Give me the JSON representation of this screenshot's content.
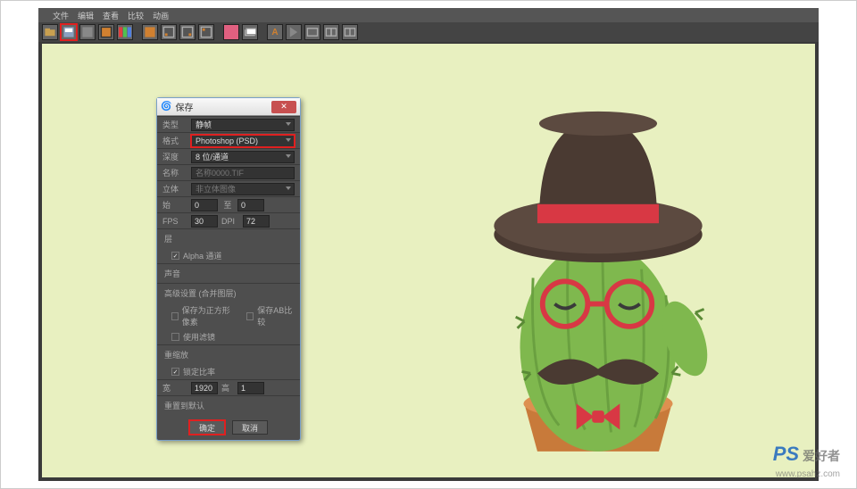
{
  "menu": {
    "items": [
      "文件",
      "编辑",
      "查看",
      "比较",
      "动画"
    ]
  },
  "dialog": {
    "title": "保存",
    "type_label": "类型",
    "type_value": "静帧",
    "format_label": "格式",
    "format_value": "Photoshop (PSD)",
    "depth_label": "深度",
    "depth_value": "8 位/通道",
    "name_label": "名称",
    "name_value": "名称0000.TIF",
    "stereo_label": "立体",
    "stereo_value": "非立体图像",
    "start_label": "始",
    "start_value": "0",
    "end_label": "至",
    "end_value": "0",
    "fps_label": "FPS",
    "fps_value": "30",
    "dpi_label": "DPI",
    "dpi_value": "72",
    "layers_section": "层",
    "alpha_label": "Alpha 通道",
    "alpha_checked": true,
    "sound_section": "声音",
    "advanced_section": "高级设置 (合并图层)",
    "square_label": "保存为正方形像素",
    "ab_label": "保存AB比较",
    "filter_label": "使用滤镜",
    "rescale_section": "重缩放",
    "lock_label": "锁定比率",
    "lock_checked": true,
    "width_label": "宽",
    "width_value": "1920",
    "height_label": "高",
    "height_value": "1",
    "reset_label": "重置到默认",
    "ok": "确定",
    "cancel": "取消"
  },
  "watermark": {
    "logo": "PS",
    "name": "爱好者",
    "url": "www.psahz.com"
  }
}
